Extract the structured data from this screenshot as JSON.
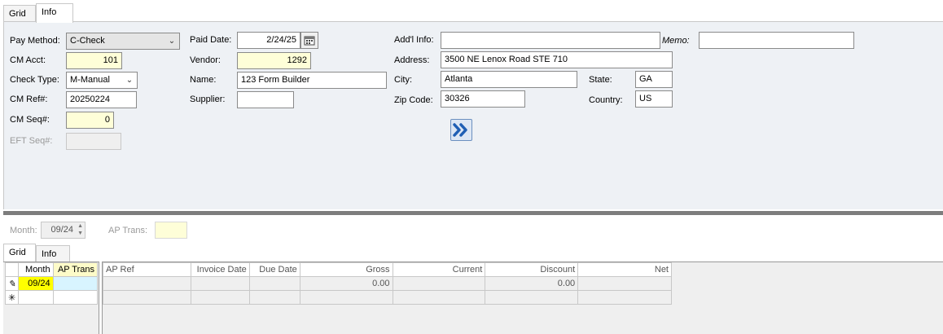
{
  "top_tabs": [
    {
      "label": "Grid"
    },
    {
      "label": "Info"
    }
  ],
  "form": {
    "pay_method": {
      "label": "Pay Method:",
      "value": "C-Check"
    },
    "cm_acct": {
      "label": "CM Acct:",
      "value": "101"
    },
    "check_type": {
      "label": "Check Type:",
      "value": "M-Manual"
    },
    "cm_ref": {
      "label": "CM Ref#:",
      "value": "20250224"
    },
    "cm_seq": {
      "label": "CM Seq#:",
      "value": "0"
    },
    "eft_seq": {
      "label": "EFT Seq#:",
      "value": ""
    },
    "paid_date": {
      "label": "Paid Date:",
      "value": "2/24/25"
    },
    "vendor": {
      "label": "Vendor:",
      "value": "1292"
    },
    "name": {
      "label": "Name:",
      "value": "123 Form Builder"
    },
    "supplier": {
      "label": "Supplier:",
      "value": ""
    },
    "addl_info": {
      "label": "Add'l Info:",
      "value": ""
    },
    "memo": {
      "label": "Memo:",
      "value": ""
    },
    "address": {
      "label": "Address:",
      "value": "3500 NE Lenox Road STE 710"
    },
    "city": {
      "label": "City:",
      "value": "Atlanta"
    },
    "state": {
      "label": "State:",
      "value": "GA"
    },
    "zip": {
      "label": "Zip Code:",
      "value": "30326"
    },
    "country": {
      "label": "Country:",
      "value": "US"
    }
  },
  "lower": {
    "month": {
      "label": "Month:",
      "value": "09/24"
    },
    "ap_trans": {
      "label": "AP Trans:",
      "value": ""
    }
  },
  "lower_tabs": [
    {
      "label": "Grid"
    },
    {
      "label": "Info"
    }
  ],
  "left_grid": {
    "headers": [
      "Month",
      "AP Trans"
    ],
    "rows": [
      [
        "09/24",
        ""
      ]
    ]
  },
  "right_grid": {
    "headers": [
      "AP Ref",
      "Invoice Date",
      "Due Date",
      "Gross",
      "Current",
      "Discount",
      "Net"
    ],
    "rows": [
      [
        "",
        "",
        "",
        "0.00",
        "",
        "0.00",
        ""
      ]
    ]
  },
  "icons": {
    "edit_row": "pencil-icon",
    "new_row": "asterisk-icon",
    "calendar": "calendar-icon",
    "advance": "double-chevron-right-icon"
  },
  "colors": {
    "required_field": "#fefed8",
    "panel": "#eef1f5",
    "highlight": "#ffff00",
    "selection": "#d8f4ff"
  }
}
